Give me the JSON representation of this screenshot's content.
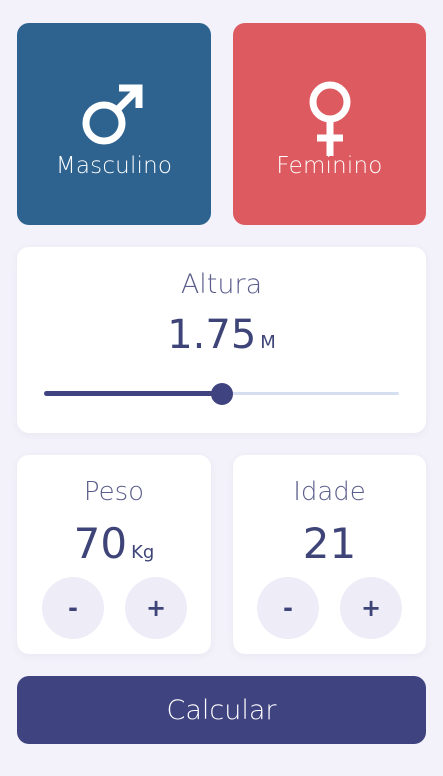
{
  "gender": {
    "male_label": "Masculino",
    "female_label": "Feminino",
    "male_icon": "male-symbol-icon",
    "female_icon": "female-symbol-icon",
    "male_color": "#2e6390",
    "female_color": "#dd5a60"
  },
  "height": {
    "title": "Altura",
    "value": "1.75",
    "unit": "M",
    "slider_fraction": 0.5
  },
  "weight": {
    "title": "Peso",
    "value": "70",
    "unit": "Kg",
    "minus": "-",
    "plus": "+"
  },
  "age": {
    "title": "Idade",
    "value": "21",
    "minus": "-",
    "plus": "+"
  },
  "action": {
    "calculate_label": "Calcular",
    "color": "#3f4380"
  }
}
